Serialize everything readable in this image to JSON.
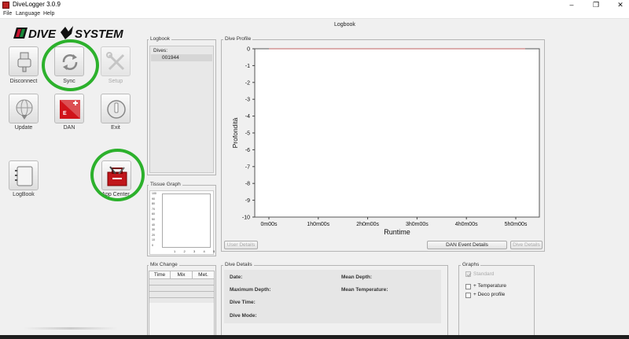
{
  "window": {
    "title": "DiveLogger 3.0.9"
  },
  "menu": [
    "File",
    "Language",
    "Help"
  ],
  "header": {
    "title": "Logbook"
  },
  "toolbar": {
    "disconnect": "Disconnect",
    "sync": "Sync",
    "setup": "Setup",
    "update": "Update",
    "dan": "DAN",
    "exit": "Exit",
    "logbook": "LogBook",
    "app_center": "App Center"
  },
  "logbook_panel": {
    "title": "Logbook",
    "dives_label": "Dives:",
    "dives": [
      "001944"
    ]
  },
  "tissue_panel": {
    "title": "Tissue Graph",
    "x_ticks": [
      "1",
      "2",
      "3",
      "4",
      "5"
    ],
    "y_ticks": [
      "100",
      "90",
      "80",
      "70",
      "60",
      "50",
      "40",
      "30",
      "20",
      "10",
      "0"
    ]
  },
  "mix_panel": {
    "title": "Mix Change",
    "columns": [
      "Time",
      "Mix",
      "Met."
    ]
  },
  "profile_panel": {
    "title": "Dive Profile",
    "buttons": {
      "user_details": "User Details",
      "dan_event": "DAN Event Details",
      "dive_details": "Dive Details"
    }
  },
  "details_panel": {
    "title": "Dive Details",
    "fields": {
      "date": "Date:",
      "max_depth": "Maximum Depth:",
      "dive_time": "Dive Time:",
      "dive_mode": "Dive Mode:",
      "mean_depth": "Mean Depth:",
      "mean_temp": "Mean Temperature:"
    }
  },
  "graphs_panel": {
    "title": "Graphs",
    "standard": "Standard",
    "temperature": "+ Temperature",
    "deco": "+ Deco profile"
  },
  "chart_data": {
    "type": "line",
    "xlabel": "Runtime",
    "ylabel": "Profondità",
    "ylim": [
      -10,
      0
    ],
    "y_ticks": [
      "0",
      "-1",
      "-2",
      "-3",
      "-4",
      "-5",
      "-6",
      "-7",
      "-8",
      "-9",
      "-10"
    ],
    "x_ticks": [
      "0m00s",
      "1h0m00s",
      "2h0m00s",
      "3h0m00s",
      "4h0m00s",
      "5h0m00s"
    ],
    "series": [
      {
        "values": [
          0,
          0
        ],
        "color": "#c06060"
      }
    ]
  }
}
